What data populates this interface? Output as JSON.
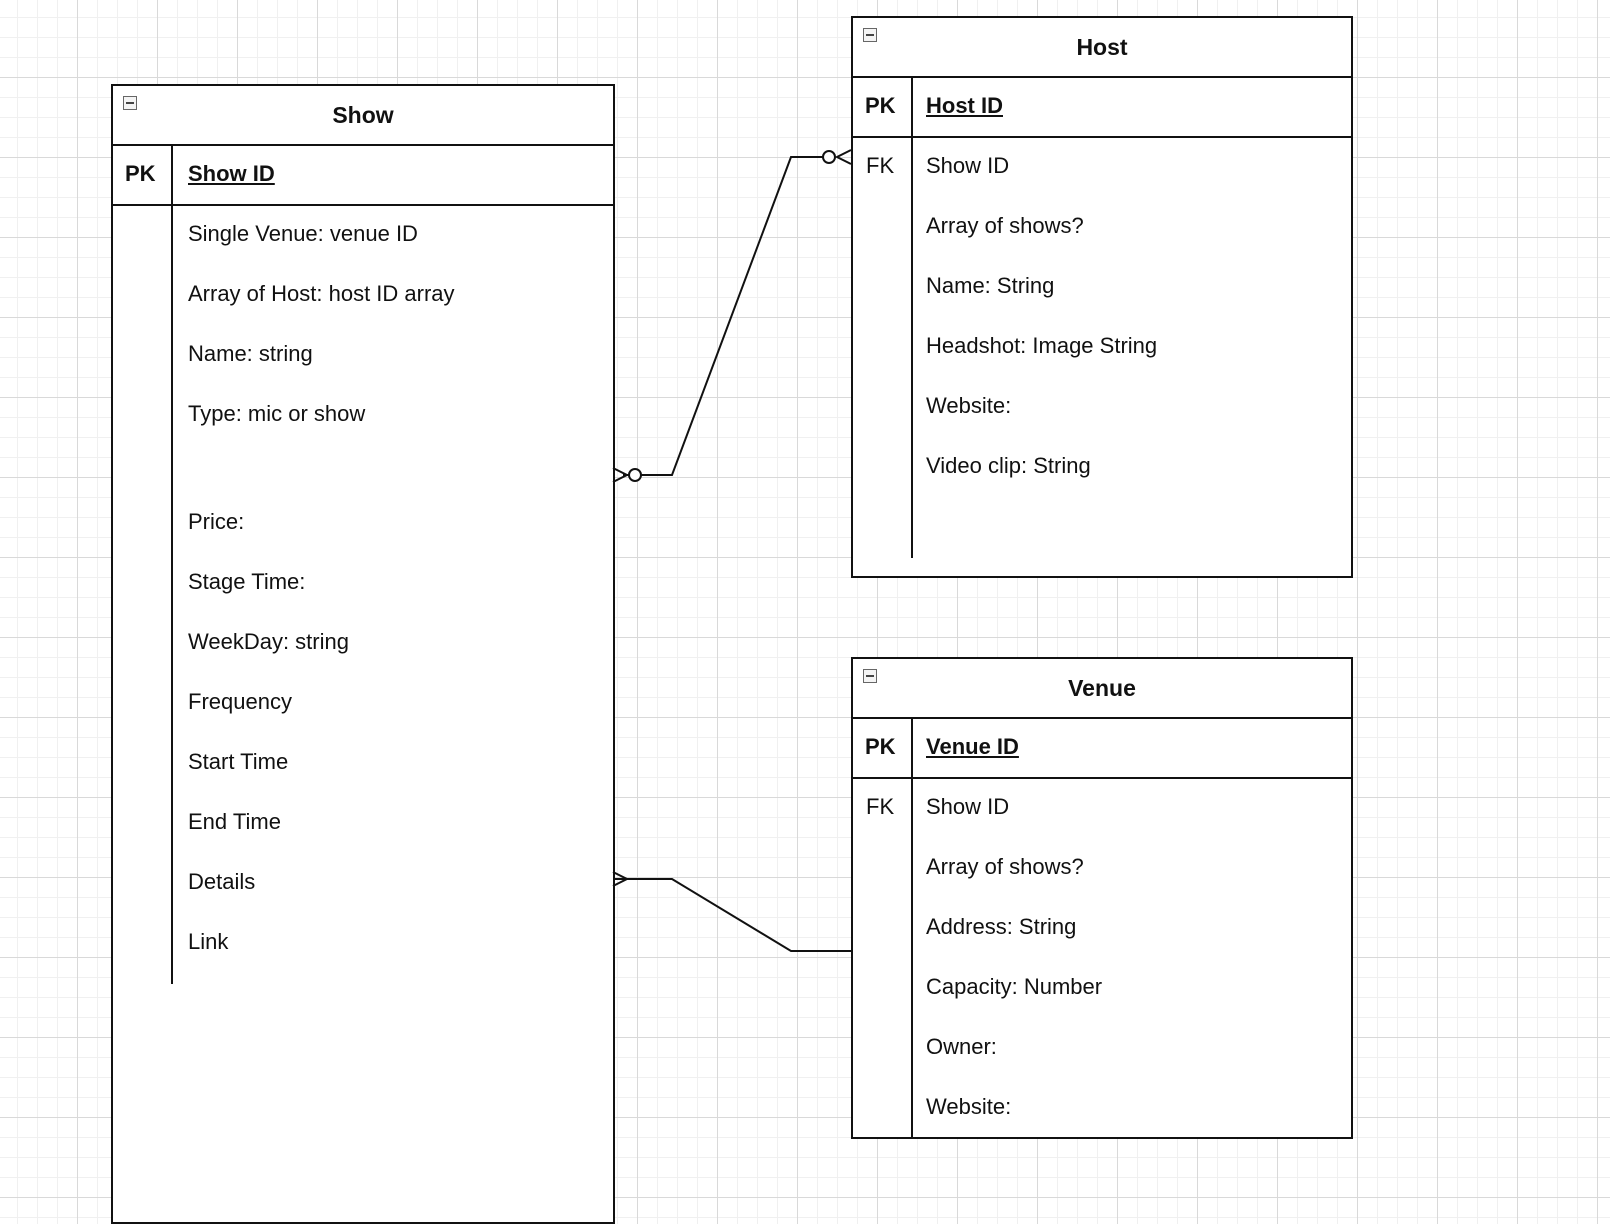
{
  "entities": {
    "show": {
      "title": "Show",
      "pk_label": "PK",
      "pk_field": "Show ID",
      "fields": [
        "Single Venue: venue ID",
        "Array of Host: host ID array",
        "Name: string",
        "Type: mic or show",
        "Price:",
        "Stage Time:",
        "WeekDay: string",
        "Frequency",
        "Start Time",
        "End Time",
        "Details",
        "Link"
      ]
    },
    "host": {
      "title": "Host",
      "pk_label": "PK",
      "pk_field": "Host ID",
      "fk_label": "FK",
      "fields": [
        "Show ID",
        "Array of shows?",
        "Name: String",
        "Headshot: Image String",
        "Website:",
        "Video clip: String"
      ]
    },
    "venue": {
      "title": "Venue",
      "pk_label": "PK",
      "pk_field": "Venue ID",
      "fk_label": "FK",
      "fields": [
        "Show ID",
        "Array of shows?",
        "Address: String",
        "Capacity: Number",
        "Owner:",
        "Website:"
      ]
    }
  },
  "relationships": [
    {
      "from": "Show",
      "to": "Host",
      "from_end": "zero-or-many",
      "to_end": "zero-or-many"
    },
    {
      "from": "Show",
      "to": "Venue",
      "from_end": "many",
      "to_end": "one"
    }
  ]
}
